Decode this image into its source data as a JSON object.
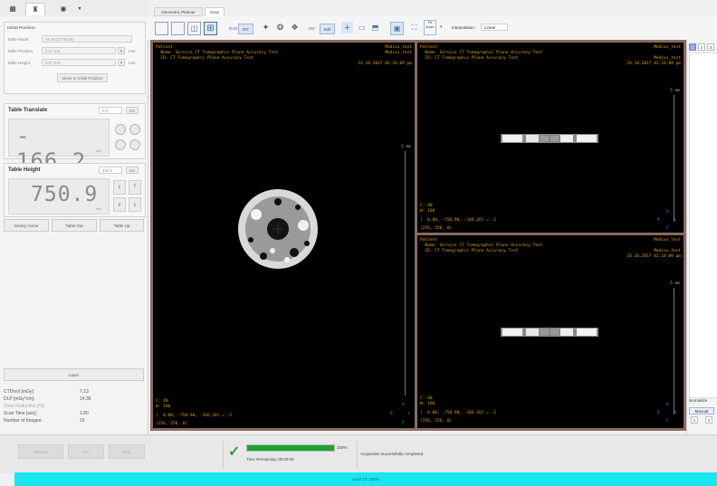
{
  "top_tabs": [
    {
      "icon": "grid-icon"
    },
    {
      "icon": "patient-icon"
    },
    {
      "icon": "scanner-icon"
    },
    {
      "icon": "chevron-down-icon"
    }
  ],
  "initial_position": {
    "title": "Initial Position",
    "table_mode_label": "Table Mode:",
    "table_mode_value": "As Is (CT-Scan)",
    "table_position_label": "Table Position:",
    "table_position_value": "0.0 / 0.0",
    "table_position_unit": "mm",
    "table_height_label": "Table Height:",
    "table_height_value": "0.0 / 0.0",
    "table_height_unit": "mm",
    "move_button": "Move to Initial Position"
  },
  "table_translate": {
    "title": "Table Translate",
    "step_value": "0.0",
    "go_label": "Go",
    "display": "- 166.2",
    "unit": "mm"
  },
  "table_height": {
    "title": "Table Height",
    "step_value": "462.5",
    "go_label": "Go",
    "display": "750.9",
    "unit": "mm"
  },
  "gantry_buttons": [
    "Gantry Home",
    "Table Out",
    "Table Up"
  ],
  "laser_button": "Laser",
  "dose_stats": [
    {
      "label": "CTDIvol [mGy]:",
      "value": "7.13"
    },
    {
      "label": "DLP [mGy*cm]:",
      "value": "14.36"
    },
    {
      "label": "Dose Reduction [%]:",
      "value": ""
    },
    {
      "label": "Scan Time [sec]:",
      "value": "1.80"
    },
    {
      "label": "Number of Images:",
      "value": "15"
    }
  ],
  "view_tabs": {
    "geometric": "Geometric Planner",
    "scan": "Scan"
  },
  "toolbar": {
    "rad": "RAD",
    "int": "INT",
    "sel": "Sel",
    "edit": "Edit",
    "fit": "Fit Zoom",
    "interpolation_label": "Interpolation:",
    "interpolation_value": "Linear"
  },
  "viewer": {
    "patient": "Patient",
    "name_line": "  Name: Service CT Tomographic Plane Accuracy Test",
    "id_line": "  ID: CT Tomographic Plane Accuracy Test",
    "site": "Medixx_test",
    "date": "24.10.2017 02:24:09 pm",
    "c_line": "C: 40",
    "w_line": "W: 160",
    "coord_line": "[  0.00, -750.90, -166.20] = -2",
    "dim_line": "(256, 256, 0)",
    "ruler_label": "5 mm",
    "orient_r": "R",
    "orient_l": "L",
    "orient_a": "A",
    "orient_p": "P",
    "orient_h": "H",
    "orient_f": "F"
  },
  "side_panel": {
    "numbers": [
      "1",
      "2",
      "3"
    ],
    "normalize": "Normalize",
    "manual": "Manual",
    "steps": [
      "1",
      "2"
    ]
  },
  "bottom": {
    "prepare": "Prepare",
    "go": "Go",
    "stop": "Stop",
    "progress_percent": "100%",
    "progress_value": 100,
    "time_remaining": "Time Remaining:  00:00:00",
    "message": "Acquisition successfully completed."
  },
  "status_bar": "Axial CT 100%"
}
